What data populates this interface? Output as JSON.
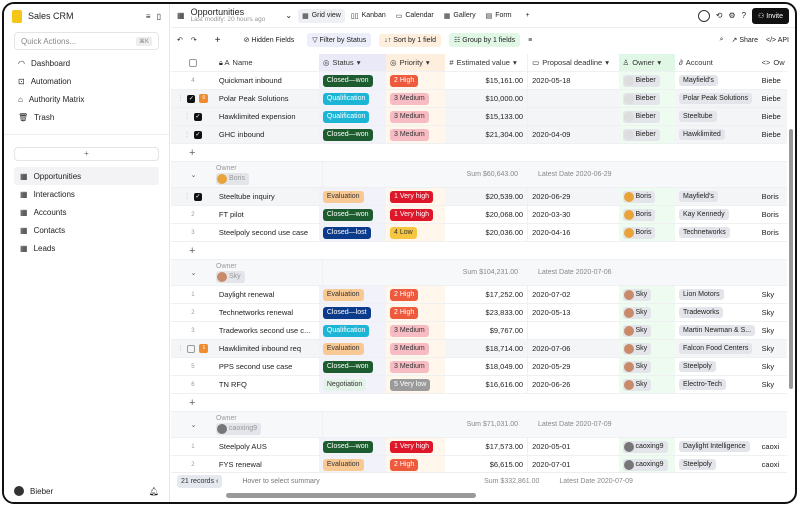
{
  "sidebar": {
    "app_name": "Sales CRM",
    "search_placeholder": "Quick Actions...",
    "shortcut": "⌘K",
    "nav": [
      {
        "label": "Dashboard",
        "icon": "gauge-icon"
      },
      {
        "label": "Automation",
        "icon": "robot-icon"
      },
      {
        "label": "Authority Matrix",
        "icon": "lock-icon"
      },
      {
        "label": "Trash",
        "icon": "trash-icon"
      }
    ],
    "tables": [
      {
        "label": "Opportunities",
        "active": true
      },
      {
        "label": "Interactions"
      },
      {
        "label": "Accounts"
      },
      {
        "label": "Contacts"
      },
      {
        "label": "Leads"
      }
    ],
    "add": "+",
    "user": "Bieber"
  },
  "header": {
    "title": "Opportunities",
    "subtitle": "Last modify: 20 hours ago",
    "views": [
      "Grid view",
      "Kanban",
      "Calendar",
      "Gallery",
      "Form"
    ],
    "add": "+",
    "invite": "Invite"
  },
  "toolbar": {
    "hidden_fields": "Hidden Fields",
    "filter": "Filter by Status",
    "sort": "Sort by 1 field",
    "group": "Group by 1 fields",
    "share": "Share",
    "api": "API"
  },
  "columns": [
    "Name",
    "Status",
    "Priority",
    "Estimated value",
    "Proposal deadline",
    "Owner",
    "Account",
    "Ow"
  ],
  "colors": {
    "Closed—won": "#1d5c2e",
    "Qualification": "#1cb5d6",
    "Evaluation": "#f9c994",
    "Closed—lost": "#0b3b8a",
    "Negotiation": "#e3f3e8",
    "2 High": "#ee5a3d",
    "3 Medium": "#f7bcc3",
    "1 Very high": "#dd1629",
    "4 Low": "#f6c641",
    "5 Very low": "#9b9b9b"
  },
  "groups": [
    {
      "owner": "Bieber",
      "rows": [
        {
          "n": "4",
          "name": "Quickmart inbound",
          "status": "Closed—won",
          "priority": "2 High",
          "value": "$15,161.00",
          "deadline": "2020-05-18",
          "owner": "Bieber",
          "account": "Mayfield's",
          "ow": "Biebe"
        },
        {
          "n": "",
          "checked": true,
          "badge": "0",
          "name": "Polar Peak Solutions",
          "status": "Qualification",
          "priority": "3 Medium",
          "value": "$10,000.00",
          "deadline": "",
          "owner": "Bieber",
          "account": "Polar Peak Solutions",
          "ow": "Biebe"
        },
        {
          "n": "",
          "checked": true,
          "name": "Hawklimited expension",
          "status": "Qualification",
          "priority": "3 Medium",
          "value": "$15,133.00",
          "deadline": "",
          "owner": "Bieber",
          "account": "Steeltube",
          "ow": "Biebe"
        },
        {
          "n": "",
          "checked": true,
          "name": "GHC inbound",
          "status": "Closed—won",
          "priority": "3 Medium",
          "value": "$21,304.00",
          "deadline": "2020-04-09",
          "owner": "Bieber",
          "account": "Hawklimited",
          "ow": "Biebe"
        }
      ]
    },
    {
      "label": "Owner",
      "owner": "Boris",
      "sum": "Sum $60,643.00",
      "latest": "Latest Date 2020-06-29",
      "rows": [
        {
          "n": "",
          "checked": true,
          "name": "Steeltube inquiry",
          "status": "Evaluation",
          "priority": "1 Very high",
          "value": "$20,539.00",
          "deadline": "2020-06-29",
          "owner": "Boris",
          "account": "Mayfield's",
          "ow": "Boris"
        },
        {
          "n": "2",
          "name": "FT pilot",
          "status": "Closed—won",
          "priority": "1 Very high",
          "value": "$20,068.00",
          "deadline": "2020-03-30",
          "owner": "Boris",
          "account": "Kay Kennedy",
          "ow": "Boris"
        },
        {
          "n": "3",
          "name": "Steelpoly second use case",
          "status": "Closed—lost",
          "priority": "4 Low",
          "value": "$20,036.00",
          "deadline": "2020-04-16",
          "owner": "Boris",
          "account": "Technetworks",
          "ow": "Boris"
        }
      ]
    },
    {
      "label": "Owner",
      "owner": "Sky",
      "sum": "Sum $104,231.00",
      "latest": "Latest Date 2020-07-06",
      "rows": [
        {
          "n": "1",
          "name": "Daylight renewal",
          "status": "Evaluation",
          "priority": "2 High",
          "value": "$17,252.00",
          "deadline": "2020-07-02",
          "owner": "Sky",
          "account": "Lion Motors",
          "ow": "Sky"
        },
        {
          "n": "2",
          "name": "Technetworks renewal",
          "status": "Closed—lost",
          "priority": "2 High",
          "value": "$23,833.00",
          "deadline": "2020-05-13",
          "owner": "Sky",
          "account": "Tradeworks",
          "ow": "Sky"
        },
        {
          "n": "3",
          "name": "Tradeworks second use c...",
          "status": "Qualification",
          "priority": "3 Medium",
          "value": "$9,767.00",
          "deadline": "",
          "owner": "Sky",
          "account": "Martin Newman & S...",
          "ow": "Sky"
        },
        {
          "n": "",
          "checked": false,
          "badge": "1",
          "name": "Hawklimited inbound req",
          "status": "Evaluation",
          "priority": "3 Medium",
          "value": "$18,714.00",
          "deadline": "2020-07-06",
          "owner": "Sky",
          "account": "Falcon Food Centers",
          "ow": "Sky"
        },
        {
          "n": "5",
          "name": "PPS second use case",
          "status": "Closed—won",
          "priority": "3 Medium",
          "value": "$18,049.00",
          "deadline": "2020-05-29",
          "owner": "Sky",
          "account": "Steelpoly",
          "ow": "Sky"
        },
        {
          "n": "6",
          "name": "TN RFQ",
          "status": "Negotiation",
          "priority": "5 Very low",
          "value": "$16,616.00",
          "deadline": "2020-06-26",
          "owner": "Sky",
          "account": "Electro-Tech",
          "ow": "Sky"
        }
      ]
    },
    {
      "label": "Owner",
      "owner": "caoxing9",
      "sum": "Sum $71,031.00",
      "latest": "Latest Date 2020-07-09",
      "rows": [
        {
          "n": "1",
          "name": "Steelpoly AUS",
          "status": "Closed—won",
          "priority": "1 Very high",
          "value": "$17,573.00",
          "deadline": "2020-05-01",
          "owner": "caoxing9",
          "account": "Daylight Intelligence",
          "ow": "caoxi"
        },
        {
          "n": "2",
          "name": "FYS renewal",
          "status": "Evaluation",
          "priority": "2 High",
          "value": "$6,615.00",
          "deadline": "2020-07-01",
          "owner": "caoxing9",
          "account": "Steelpoly",
          "ow": "caoxi"
        }
      ]
    }
  ],
  "footer": {
    "records": "21 records",
    "hint": "Hover to select summary",
    "sum": "Sum $332,861.00",
    "latest": "Latest Date 2020-07-09"
  }
}
